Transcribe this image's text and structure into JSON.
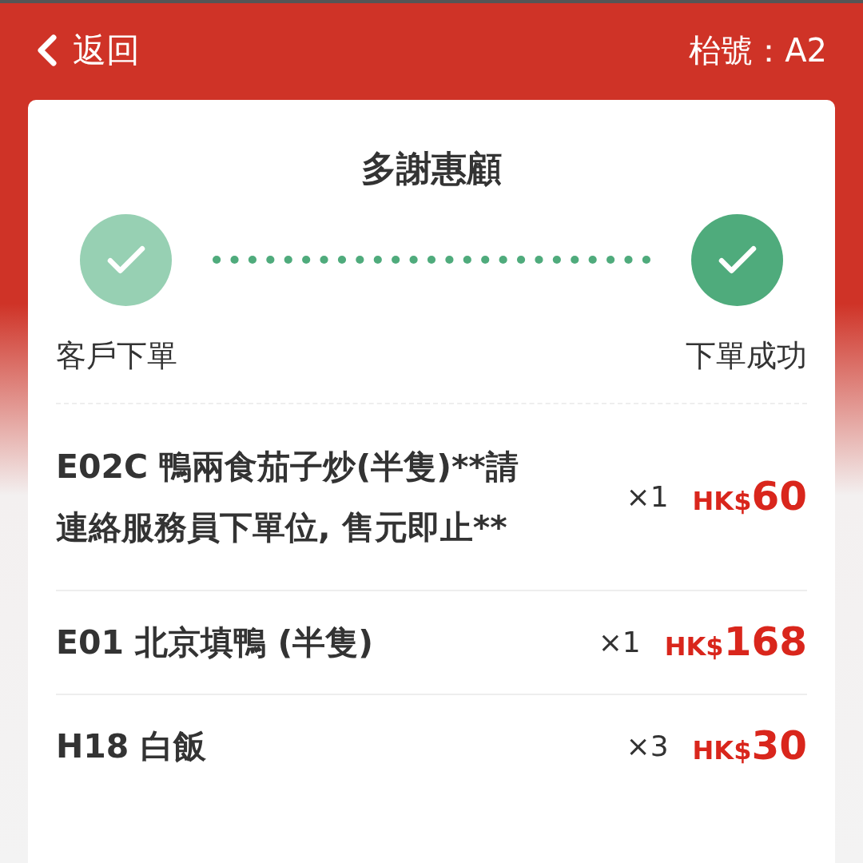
{
  "header": {
    "back_label": "返回",
    "table_label": "枱號：A2"
  },
  "card": {
    "title": "多謝惠顧",
    "steps": [
      {
        "label": "客戶下單",
        "current": false
      },
      {
        "label": "下單成功",
        "current": true
      }
    ],
    "items": [
      {
        "name": "E02C 鴨兩食茄子炒(半隻)**請連絡服務員下單位, 售元即止**",
        "quantity": "×1",
        "currency": "HK$",
        "amount": "60"
      },
      {
        "name": "E01 北京填鴨 (半隻)",
        "quantity": "×1",
        "currency": "HK$",
        "amount": "168"
      },
      {
        "name": "H18 白飯",
        "quantity": "×3",
        "currency": "HK$",
        "amount": "30"
      }
    ]
  }
}
